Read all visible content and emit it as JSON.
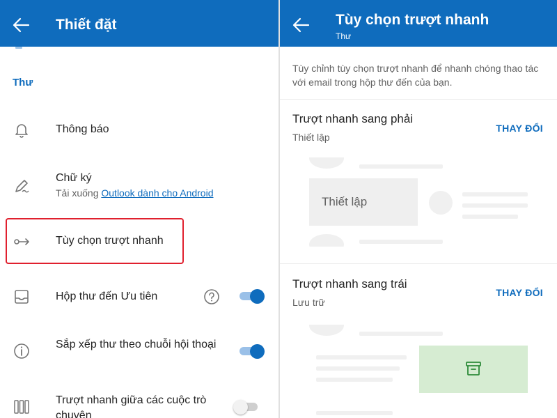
{
  "left": {
    "title": "Thiết đặt",
    "section_label": "Thư",
    "items": [
      {
        "label": "Thông báo",
        "icon": "bell-icon"
      },
      {
        "label": "Chữ ký",
        "icon": "pen-icon",
        "sub_prefix": "Tải xuống ",
        "sub_link": "Outlook dành cho Android"
      },
      {
        "label": "Tùy chọn trượt nhanh",
        "icon": "swipe-arrow-icon"
      },
      {
        "label": "Hộp thư đến Ưu tiên",
        "icon": "inbox-tray-icon",
        "toggle": "on"
      },
      {
        "label": "Sắp xếp thư theo chuỗi hội thoại",
        "icon": "info-icon",
        "toggle": "on"
      },
      {
        "label": "Trượt nhanh giữa các cuộc trò chuyện",
        "icon": "columns-icon",
        "toggle": "off"
      }
    ]
  },
  "right": {
    "title": "Tùy chọn trượt nhanh",
    "subtitle": "Thư",
    "description": "Tùy chỉnh tùy chọn trượt nhanh để nhanh chóng thao tác với email trong hộp thư đến của bạn.",
    "swipe_right": {
      "title": "Trượt nhanh sang phải",
      "value": "Thiết lập",
      "change": "THAY ĐỔI",
      "preview_label": "Thiết lập"
    },
    "swipe_left": {
      "title": "Trượt nhanh sang trái",
      "value": "Lưu trữ",
      "change": "THAY ĐỔI",
      "icon": "archive-icon"
    }
  },
  "colors": {
    "accent": "#0f6cbd",
    "highlight": "#e0202e",
    "archive_bg": "#d6ecd2",
    "archive_icon": "#2e8b3a"
  }
}
